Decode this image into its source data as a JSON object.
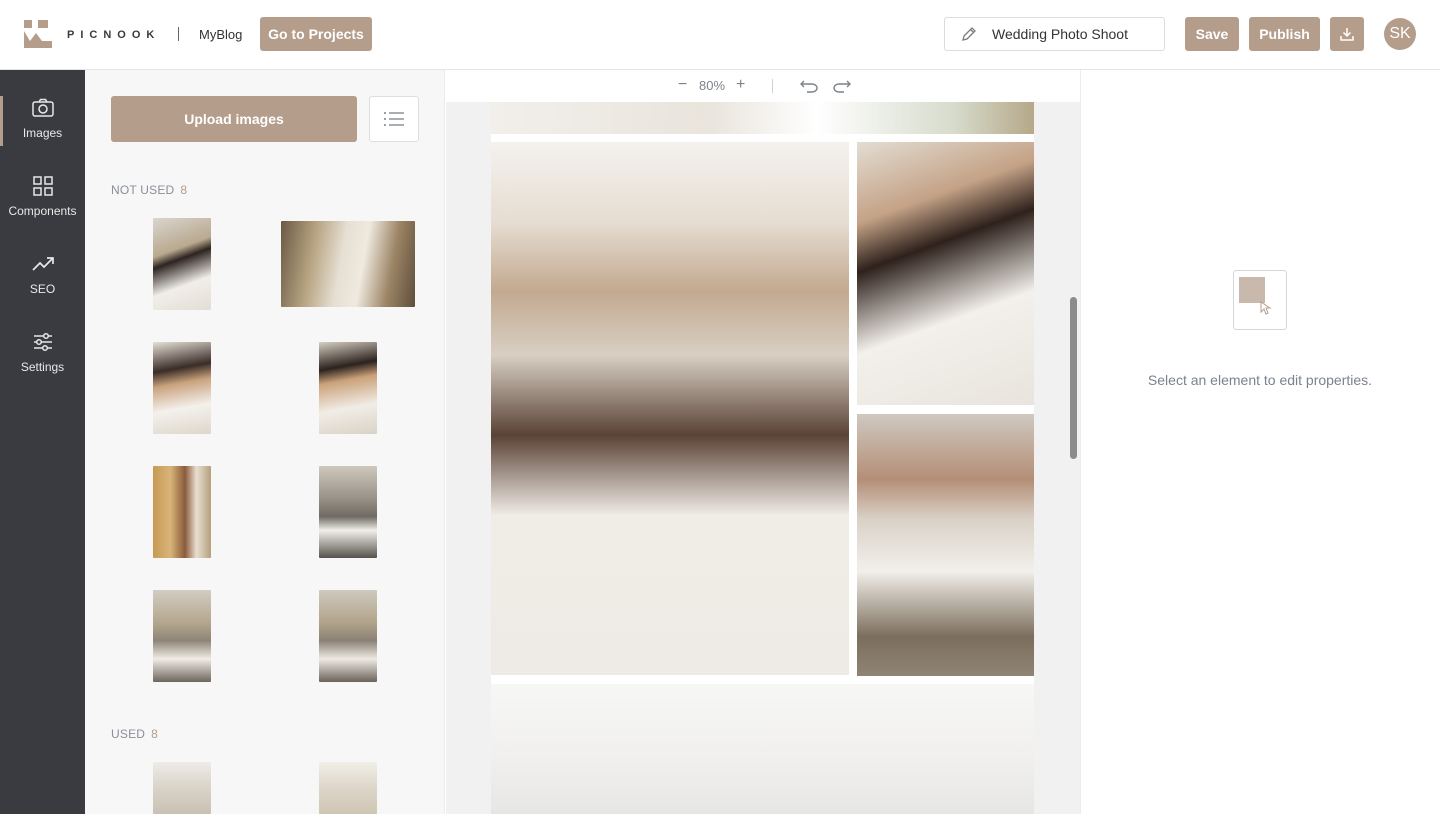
{
  "header": {
    "brand": "PICNOOK",
    "blog_name": "MyBlog",
    "go_projects_label": "Go to Projects",
    "project_title": "Wedding Photo Shoot",
    "save_label": "Save",
    "publish_label": "Publish",
    "avatar_initials": "SK"
  },
  "nav": {
    "items": [
      {
        "label": "Images",
        "icon": "camera-icon"
      },
      {
        "label": "Components",
        "icon": "grid-icon"
      },
      {
        "label": "SEO",
        "icon": "trend-icon"
      },
      {
        "label": "Settings",
        "icon": "sliders-icon"
      }
    ]
  },
  "panel": {
    "upload_label": "Upload images",
    "not_used_label": "NOT USED",
    "not_used_count": "8",
    "used_label": "USED",
    "used_count": "8"
  },
  "canvas": {
    "zoom": "80%"
  },
  "properties": {
    "empty_text": "Select an element to edit properties."
  },
  "colors": {
    "accent": "#b49d8b",
    "nav_bg": "#3a3b40"
  }
}
